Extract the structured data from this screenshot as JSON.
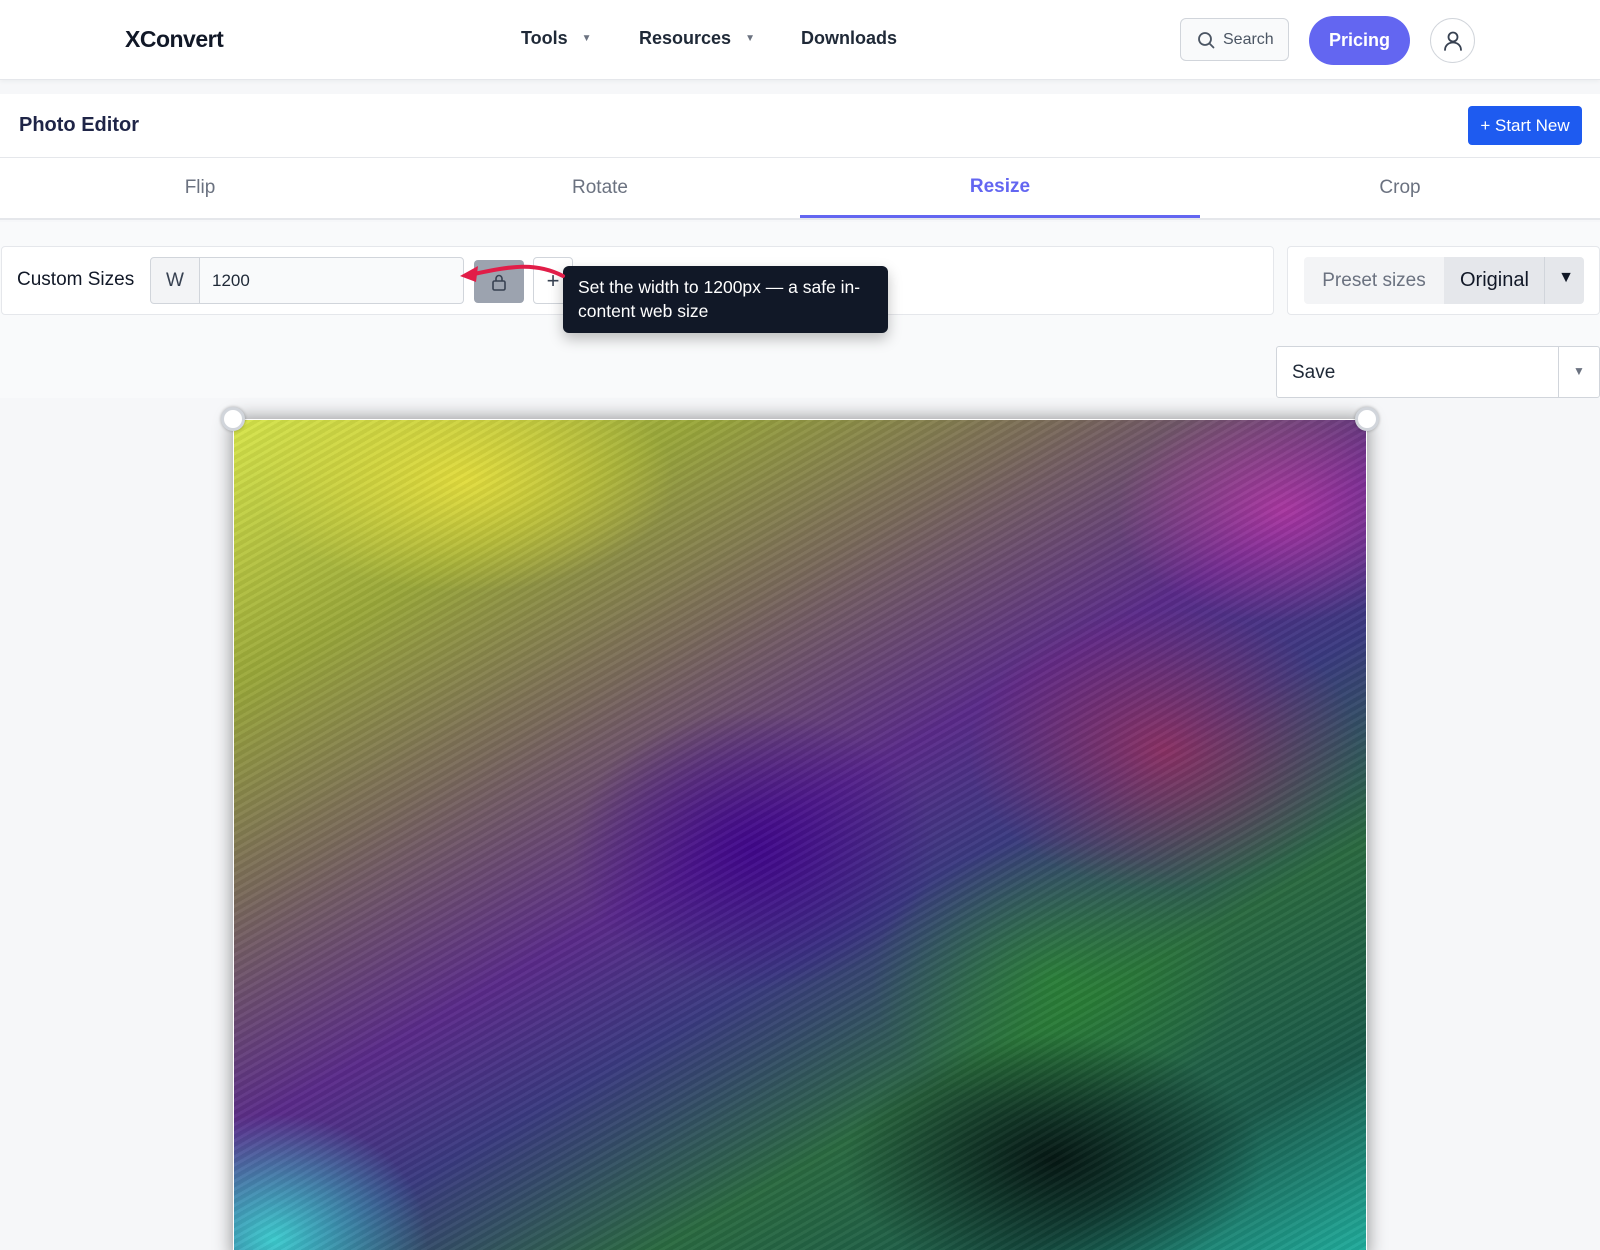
{
  "brand": "XConvert",
  "nav": {
    "tools": "Tools",
    "resources": "Resources",
    "downloads": "Downloads",
    "caret": "▼"
  },
  "search": {
    "label": "Search"
  },
  "pricing": "Pricing",
  "editor": {
    "title": "Photo Editor",
    "start_new": "+ Start New"
  },
  "tabs": [
    "Flip",
    "Rotate",
    "Resize",
    "Crop"
  ],
  "active_tab": "Resize",
  "resize": {
    "custom_label": "Custom Sizes",
    "w_label": "W",
    "width_value": "1200",
    "plus": "+",
    "preset_label": "Preset sizes",
    "preset_value": "Original",
    "preset_caret": "▼"
  },
  "tooltip": "Set the width to 1200px — a safe in-content web size",
  "save": {
    "label": "Save",
    "caret": "▼"
  },
  "colors": {
    "accent": "#6366f1",
    "start_new_bg": "#1e5bf0",
    "tooltip_bg": "#111827",
    "annotation_arrow": "#e11d48"
  }
}
